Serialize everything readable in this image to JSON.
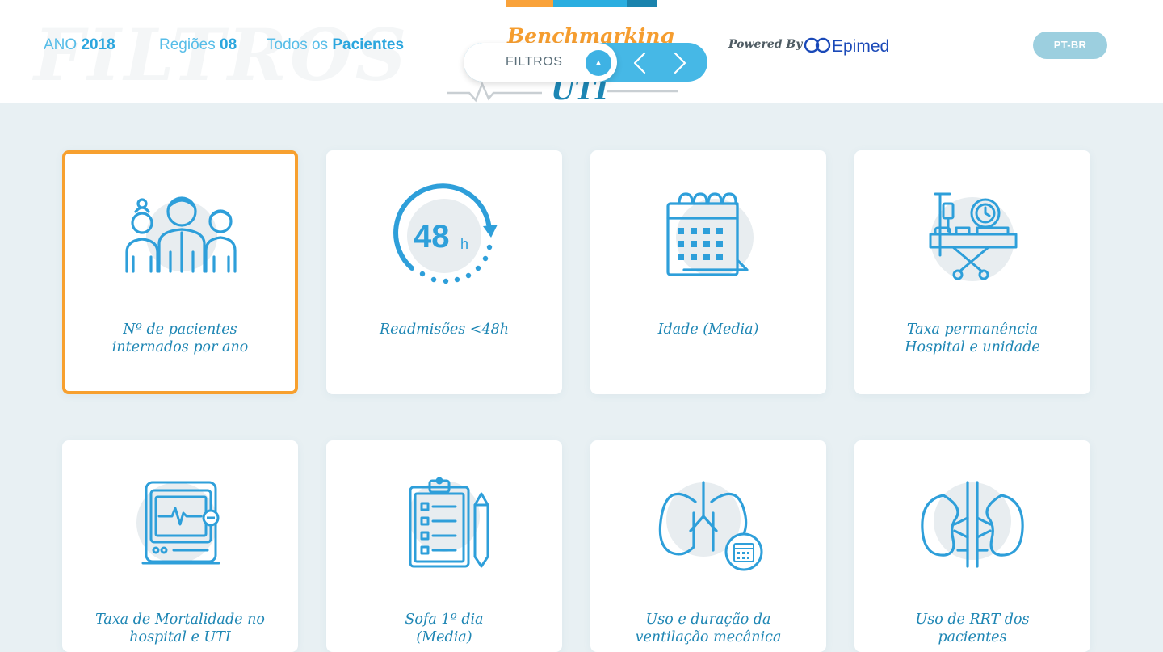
{
  "header": {
    "ghost_title": "FILTROS",
    "stats": {
      "ano_label": "ANO",
      "ano_value": "2018",
      "regioes_label": "Regiões",
      "regioes_value": "08",
      "pacientes_label": "Todos os",
      "pacientes_value": "Pacientes"
    },
    "logo": {
      "title": "Benchmarking",
      "subtitle": "UTI"
    },
    "filter": {
      "label": "FILTROS",
      "toggle_glyph": "▲"
    },
    "powered_by": "Powered By",
    "brand": "Epimed",
    "language": "PT-BR"
  },
  "colors": {
    "accent": "#2ba6de",
    "brand_orange": "#f7a02f",
    "brand_dark_blue": "#1d86b4",
    "background": "#e8f0f3"
  },
  "cards": [
    {
      "label": "Nº de pacientes\ninternados por ano",
      "icon": "patients-group-icon",
      "selected": true
    },
    {
      "label": "Readmisões <48h",
      "icon": "clock-48h-icon",
      "badge_number": "48",
      "badge_unit": "h"
    },
    {
      "label": "Idade (Media)",
      "icon": "calendar-icon"
    },
    {
      "label": "Taxa permanência\nHospital e unidade",
      "icon": "hospital-bed-icon"
    },
    {
      "label": "Taxa de Mortalidade no\nhospital e UTI",
      "icon": "heart-monitor-icon"
    },
    {
      "label": "Sofa 1º dia\n(Media)",
      "icon": "clipboard-icon"
    },
    {
      "label": "Uso e duração da\nventilação mecânica",
      "icon": "lungs-icon"
    },
    {
      "label": "Uso de RRT dos\npacientes",
      "icon": "kidneys-icon"
    }
  ]
}
